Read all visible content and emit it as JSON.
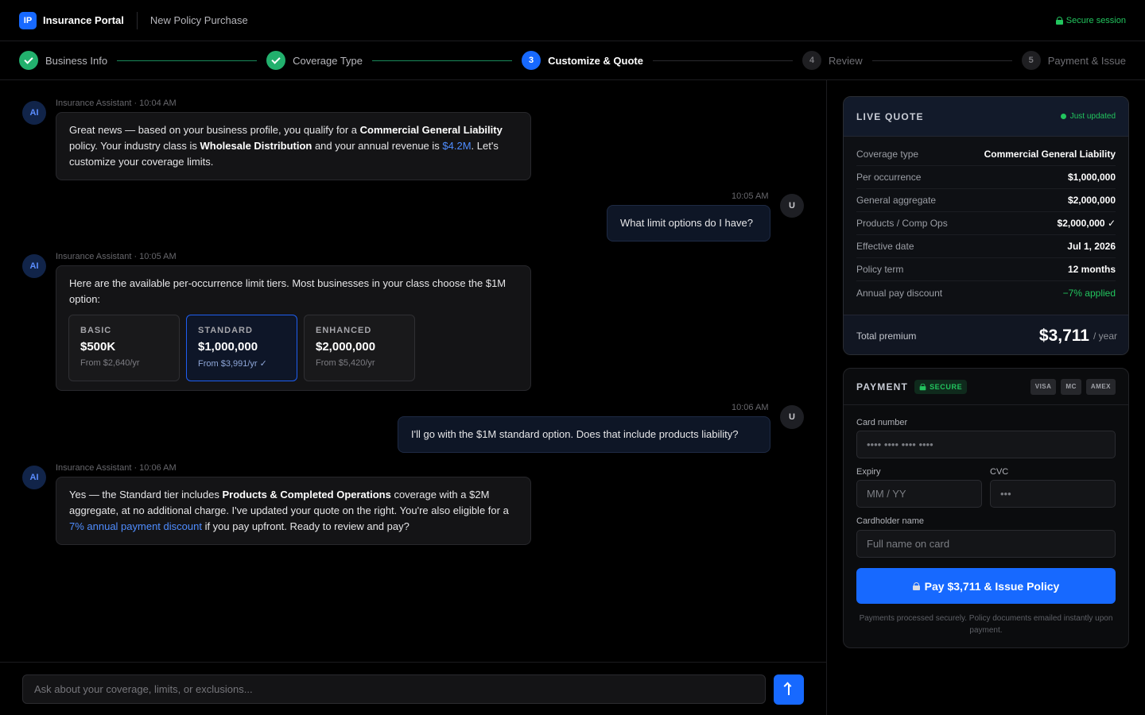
{
  "header": {
    "logo_text": "IP",
    "app_title": "Insurance Portal",
    "page_title": "New Policy Purchase",
    "secure_session": "Secure session"
  },
  "stepper": {
    "steps": [
      {
        "number": "1",
        "label": "Business Info",
        "state": "done"
      },
      {
        "number": "2",
        "label": "Coverage Type",
        "state": "done"
      },
      {
        "number": "3",
        "label": "Customize & Quote",
        "state": "active"
      },
      {
        "number": "4",
        "label": "Review",
        "state": "todo"
      },
      {
        "number": "5",
        "label": "Payment & Issue",
        "state": "todo"
      }
    ]
  },
  "chat": {
    "ai_avatar": "AI",
    "user_avatar": "U",
    "messages": [
      {
        "sender": "ai",
        "meta": "Insurance Assistant · 10:04 AM",
        "p1": "Great news — based on your business profile, you qualify for a ",
        "b1": "Commercial General Liability",
        "p2": " policy. Your industry class is ",
        "b2": "Wholesale Distribution",
        "p3": " and your annual revenue is ",
        "hl": "$4.2M",
        "p4": ". Let's customize your coverage limits."
      },
      {
        "sender": "user",
        "meta": "10:05 AM",
        "text": "What limit options do I have?"
      },
      {
        "sender": "ai",
        "meta": "Insurance Assistant · 10:05 AM",
        "text": "Here are the available per-occurrence limit tiers. Most businesses in your class choose the $1M option:",
        "tiers": [
          {
            "name": "BASIC",
            "price": "$500K",
            "from": "From $2,640/yr",
            "selected": false
          },
          {
            "name": "STANDARD",
            "price": "$1,000,000",
            "from": "From $3,991/yr ✓",
            "selected": true
          },
          {
            "name": "ENHANCED",
            "price": "$2,000,000",
            "from": "From $5,420/yr",
            "selected": false
          }
        ]
      },
      {
        "sender": "user",
        "meta": "10:06 AM",
        "text": "I'll go with the $1M standard option. Does that include products liability?"
      },
      {
        "sender": "ai",
        "meta": "Insurance Assistant · 10:06 AM",
        "p1": "Yes — the Standard tier includes ",
        "b1": "Products & Completed Operations",
        "p2": " coverage with a $2M aggregate, at no additional charge. I've updated your quote on the right. You're also eligible for a ",
        "hl": "7% annual payment discount",
        "p3": " if you pay upfront. Ready to review and pay?"
      }
    ]
  },
  "composer": {
    "placeholder": "Ask about your coverage, limits, or exclusions...",
    "send_icon": "arrow-up-icon"
  },
  "quote": {
    "title": "LIVE QUOTE",
    "status": "Just updated",
    "rows": [
      {
        "label": "Coverage type",
        "value": "Commercial General Liability"
      },
      {
        "label": "Per occurrence",
        "value": "$1,000,000"
      },
      {
        "label": "General aggregate",
        "value": "$2,000,000"
      },
      {
        "label": "Products / Comp Ops",
        "value": "$2,000,000 ✓"
      },
      {
        "label": "Effective date",
        "value": "Jul 1, 2026"
      },
      {
        "label": "Policy term",
        "value": "12 months"
      },
      {
        "label": "Annual pay discount",
        "value": "−7% applied"
      }
    ],
    "total_label": "Total premium",
    "total_amount": "$3,711",
    "total_period": "/ year"
  },
  "payment": {
    "title": "PAYMENT",
    "secure_badge": "SECURE",
    "card_brands": [
      "VISA",
      "MC",
      "AMEX"
    ],
    "card_number_label": "Card number",
    "card_number_placeholder": "•••• •••• •••• ••••",
    "expiry_label": "Expiry",
    "expiry_placeholder": "MM / YY",
    "cvc_label": "CVC",
    "cvc_placeholder": "•••",
    "name_label": "Cardholder name",
    "name_placeholder": "Full name on card",
    "pay_button": "Pay $3,711 & Issue Policy",
    "note": "Payments processed securely. Policy documents emailed instantly upon payment."
  },
  "colors": {
    "accent": "#1769ff",
    "success": "#22c55e",
    "background": "#000000"
  }
}
